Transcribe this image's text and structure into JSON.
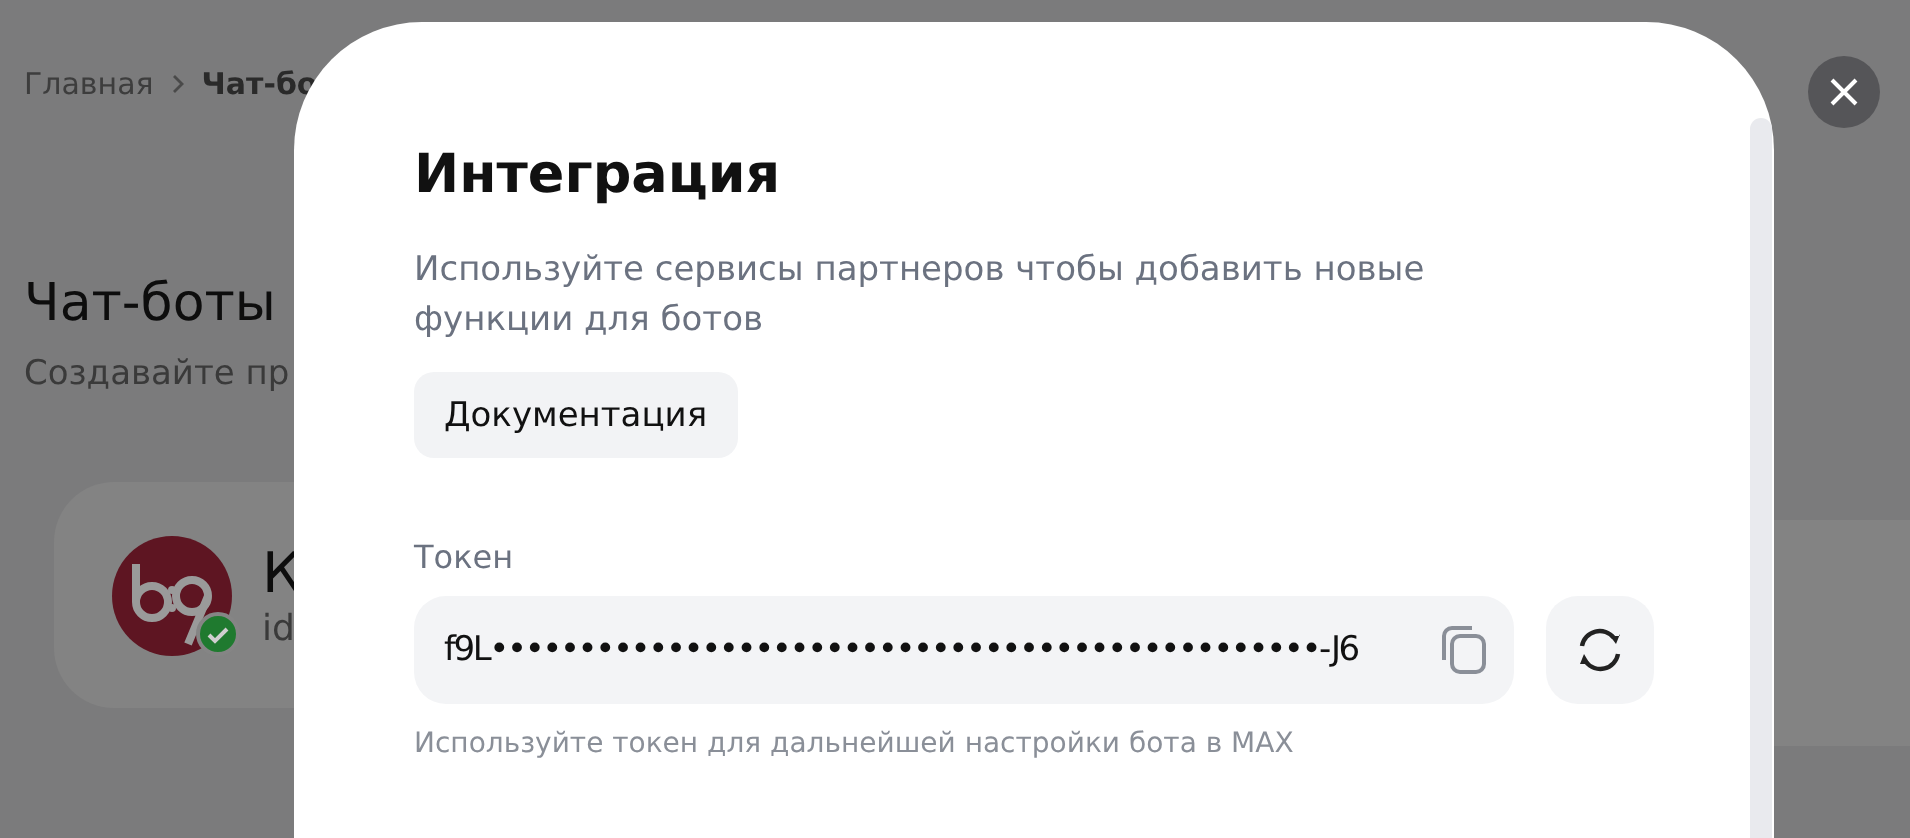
{
  "page": {
    "breadcrumb": [
      {
        "label": "Главная",
        "current": false
      },
      {
        "label": "Чат-бо",
        "current": true
      }
    ],
    "title": "Чат-боты",
    "subtitle": "Создавайте пр",
    "bot_card": {
      "name": "К",
      "id_label": "id",
      "verified": true
    }
  },
  "modal": {
    "title": "Интеграция",
    "description": "Используйте сервисы партнеров чтобы добавить новые функции для ботов",
    "documentation_button": "Документация",
    "token": {
      "label": "Токен",
      "value": "f9L•••••••••••••••••••••••••••••••••••••••••••••••-J6",
      "hint": "Используйте токен для дальнейшей настройки бота в MAX"
    }
  }
}
